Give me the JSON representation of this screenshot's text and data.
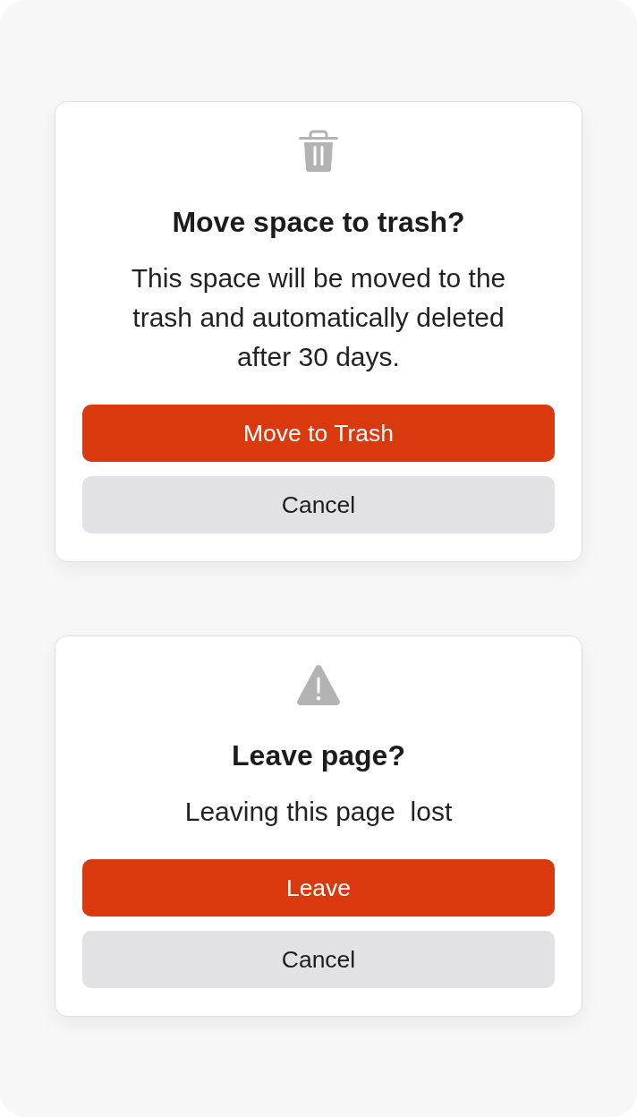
{
  "dialogs": [
    {
      "kind": "trash",
      "title": "Move space to trash?",
      "message": "This space will be moved to the trash and automatically deleted after 30 days.",
      "buttons": [
        {
          "label": "Move to Trash",
          "kind": "primary"
        },
        {
          "label": "Cancel",
          "kind": "secondary"
        }
      ]
    },
    {
      "kind": "warning",
      "title": "Leave page?",
      "message": "Leaving this page  lost",
      "buttons": [
        {
          "label": "Leave",
          "kind": "primary"
        },
        {
          "label": "Cancel",
          "kind": "secondary"
        }
      ]
    }
  ]
}
